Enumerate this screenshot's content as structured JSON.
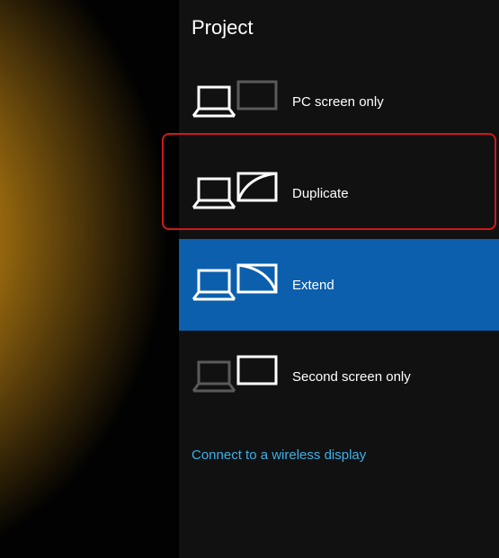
{
  "panel": {
    "title": "Project",
    "options": {
      "pc_only": "PC screen only",
      "duplicate": "Duplicate",
      "extend": "Extend",
      "second": "Second screen only"
    },
    "wireless_link": "Connect to a wireless display"
  },
  "state": {
    "selected": "extend",
    "annotated": "duplicate"
  },
  "colors": {
    "panel_bg": "#111111",
    "selected_bg": "#0b5fad",
    "annotation_border": "#d11818",
    "link": "#3db0e6"
  }
}
